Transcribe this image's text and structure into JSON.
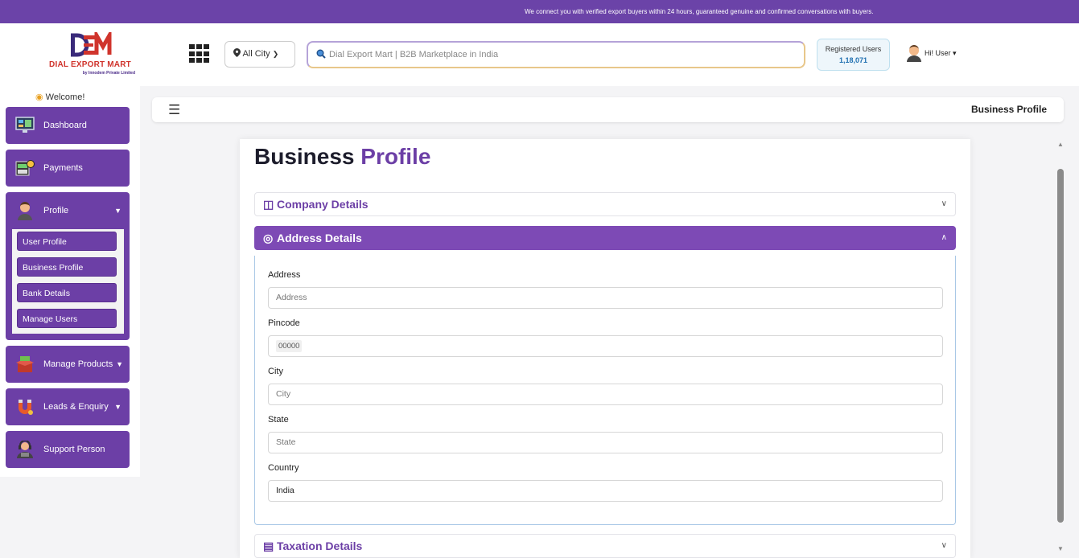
{
  "topbar": {
    "message": "We connect you with verified export buyers within 24 hours, guaranteed genuine and confirmed conversations with buyers."
  },
  "header": {
    "logo_name": "DIAL EXPORT MART",
    "logo_sub": "by Innodem Private Limited",
    "city_label": "All City",
    "search_placeholder": "Dial Export Mart | B2B Marketplace in India",
    "registered_label": "Registered Users",
    "registered_count": "1,18,071",
    "user_greeting": "Hi! User"
  },
  "sidebar": {
    "welcome": "Welcome!",
    "dashboard": "Dashboard",
    "payments": "Payments",
    "profile": "Profile",
    "profile_items": [
      "User Profile",
      "Business Profile",
      "Bank Details",
      "Manage Users"
    ],
    "manage_products": "Manage Products",
    "leads": "Leads & Enquiry",
    "support": "Support Person"
  },
  "crumb": {
    "title": "Business Profile"
  },
  "main": {
    "heading_a": "Business",
    "heading_b": "Profile",
    "sections": {
      "company": "Company Details",
      "address": "Address Details",
      "taxation": "Taxation Details"
    },
    "address_form": {
      "address_label": "Address",
      "address_placeholder": "Address",
      "pincode_label": "Pincode",
      "pincode_placeholder": "00000",
      "city_label": "City",
      "city_placeholder": "City",
      "state_label": "State",
      "state_placeholder": "State",
      "country_label": "Country",
      "country_value": "India"
    }
  },
  "colors": {
    "brand": "#6c3fa6",
    "topbar": "#6b43a8"
  }
}
